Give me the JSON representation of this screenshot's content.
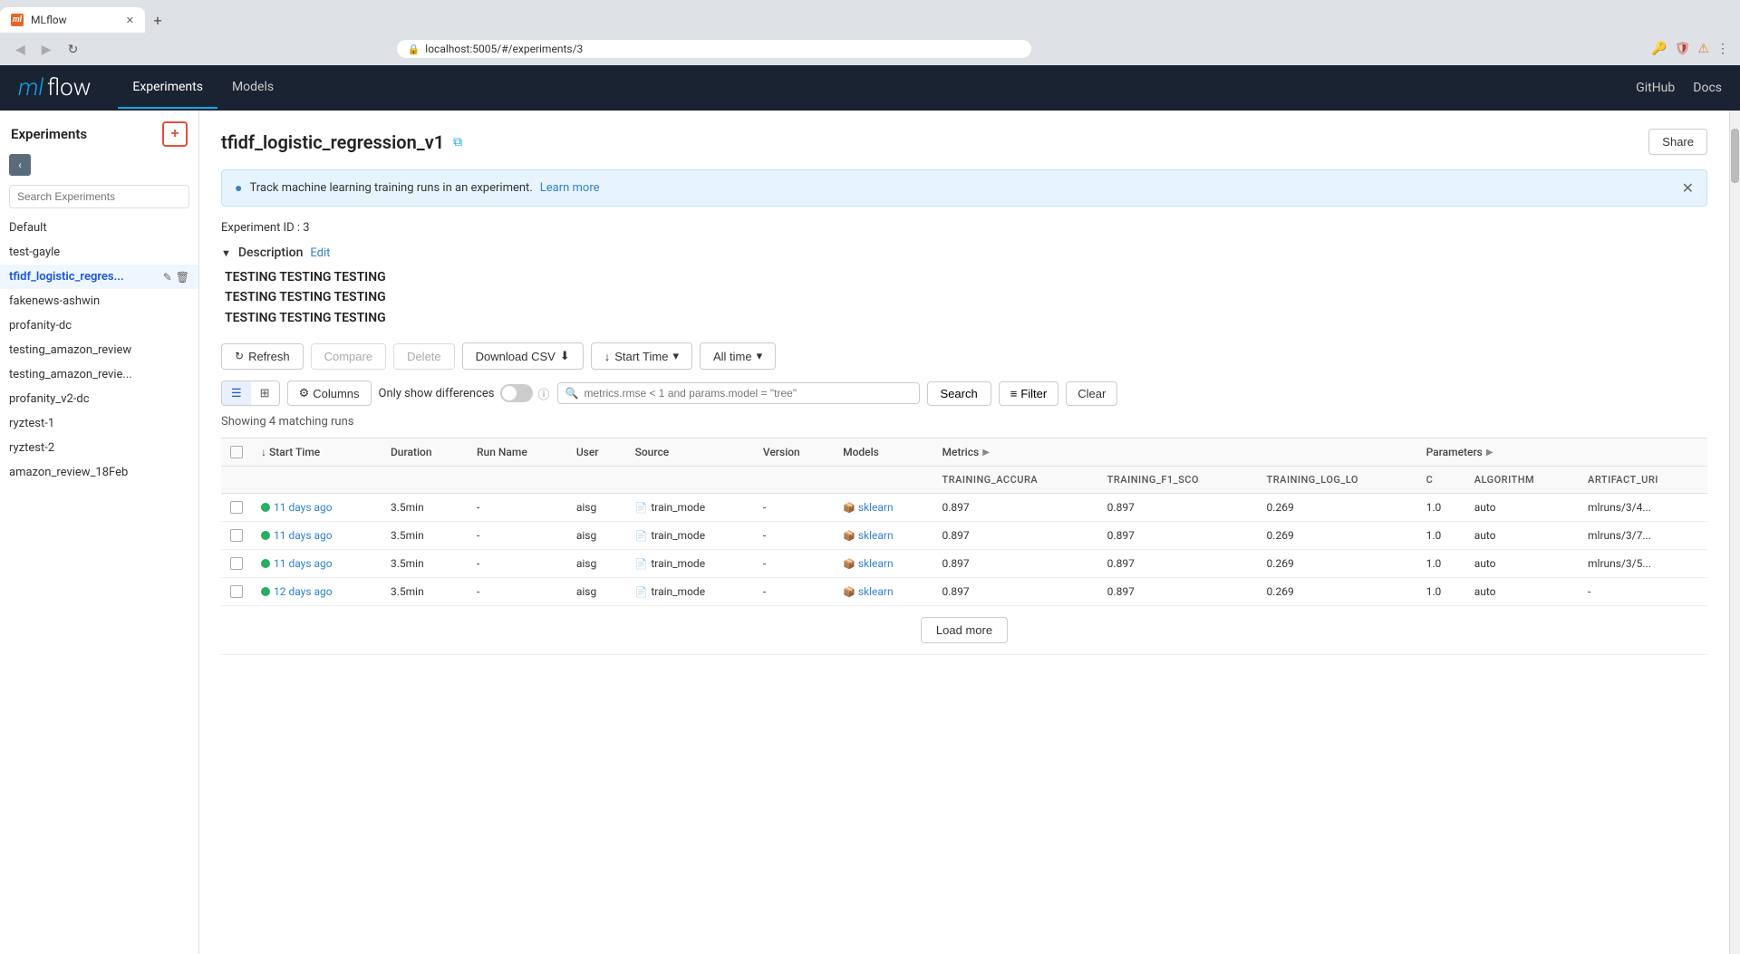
{
  "browser": {
    "tab_label": "MLflow",
    "tab_favicon": "ml",
    "url": "localhost:5005/#/experiments/3",
    "new_tab_icon": "+",
    "back_disabled": true,
    "forward_disabled": true
  },
  "header": {
    "logo_ml": "ml",
    "logo_flow": "flow",
    "nav": [
      {
        "label": "Experiments",
        "active": true
      },
      {
        "label": "Models",
        "active": false
      }
    ],
    "right_links": [
      {
        "label": "GitHub"
      },
      {
        "label": "Docs"
      }
    ]
  },
  "sidebar": {
    "title": "Experiments",
    "add_btn_label": "+",
    "collapse_btn": "‹",
    "search_placeholder": "Search Experiments",
    "items": [
      {
        "label": "Default",
        "active": false
      },
      {
        "label": "test-gayle",
        "active": false
      },
      {
        "label": "tfidf_logistic_regres...",
        "active": true
      },
      {
        "label": "fakenews-ashwin",
        "active": false
      },
      {
        "label": "profanity-dc",
        "active": false
      },
      {
        "label": "testing_amazon_review",
        "active": false
      },
      {
        "label": "testing_amazon_revie...",
        "active": false
      },
      {
        "label": "profanity_v2-dc",
        "active": false
      },
      {
        "label": "ryztest-1",
        "active": false
      },
      {
        "label": "ryztest-2",
        "active": false
      },
      {
        "label": "amazon_review_18Feb",
        "active": false
      }
    ]
  },
  "content": {
    "title": "tfidf_logistic_regression_v1",
    "share_btn": "Share",
    "info_banner": {
      "text": "Track machine learning training runs in an experiment.",
      "link_text": "Learn more"
    },
    "experiment_id_label": "Experiment ID :",
    "experiment_id_value": "3",
    "description_label": "Description",
    "description_edit": "Edit",
    "description_text_lines": [
      "TESTING TESTING TESTING",
      "TESTING TESTING TESTING",
      "TESTING TESTING TESTING"
    ],
    "toolbar": {
      "refresh_label": "Refresh",
      "compare_label": "Compare",
      "delete_label": "Delete",
      "download_csv_label": "Download CSV",
      "start_time_label": "Start Time",
      "all_time_label": "All time"
    },
    "toolbar2": {
      "columns_label": "Columns",
      "only_show_diff_label": "Only show differences",
      "search_placeholder": "metrics.rmse < 1 and params.model = \"tree\"",
      "search_btn": "Search",
      "filter_btn": "Filter",
      "clear_btn": "Clear"
    },
    "results_count": "Showing 4 matching runs",
    "table": {
      "metrics_label": "Metrics",
      "params_label": "Parameters",
      "columns": [
        {
          "label": "↓ Start Time",
          "key": "start_time"
        },
        {
          "label": "Duration",
          "key": "duration"
        },
        {
          "label": "Run Name",
          "key": "run_name"
        },
        {
          "label": "User",
          "key": "user"
        },
        {
          "label": "Source",
          "key": "source"
        },
        {
          "label": "Version",
          "key": "version"
        },
        {
          "label": "Models",
          "key": "models"
        }
      ],
      "metric_columns": [
        {
          "label": "training_accura"
        },
        {
          "label": "training_f1_sco"
        },
        {
          "label": "training_log_lo"
        }
      ],
      "param_columns": [
        {
          "label": "C"
        },
        {
          "label": "algorithm"
        },
        {
          "label": "artifact_uri"
        }
      ],
      "rows": [
        {
          "start_time": "11 days ago",
          "duration": "3.5min",
          "run_name": "-",
          "user": "aisg",
          "source": "train_mode",
          "version": "-",
          "models": "sklearn",
          "training_accuracy": "0.897",
          "training_f1": "0.897",
          "training_log": "0.269",
          "C": "1.0",
          "algorithm": "auto",
          "artifact_uri": "mlruns/3/4..."
        },
        {
          "start_time": "11 days ago",
          "duration": "3.5min",
          "run_name": "-",
          "user": "aisg",
          "source": "train_mode",
          "version": "-",
          "models": "sklearn",
          "training_accuracy": "0.897",
          "training_f1": "0.897",
          "training_log": "0.269",
          "C": "1.0",
          "algorithm": "auto",
          "artifact_uri": "mlruns/3/7..."
        },
        {
          "start_time": "11 days ago",
          "duration": "3.5min",
          "run_name": "-",
          "user": "aisg",
          "source": "train_mode",
          "version": "-",
          "models": "sklearn",
          "training_accuracy": "0.897",
          "training_f1": "0.897",
          "training_log": "0.269",
          "C": "1.0",
          "algorithm": "auto",
          "artifact_uri": "mlruns/3/5..."
        },
        {
          "start_time": "12 days ago",
          "duration": "3.5min",
          "run_name": "-",
          "user": "aisg",
          "source": "train_mode",
          "version": "-",
          "models": "sklearn",
          "training_accuracy": "0.897",
          "training_f1": "0.897",
          "training_log": "0.269",
          "C": "1.0",
          "algorithm": "auto",
          "artifact_uri": "-"
        }
      ],
      "load_more_btn": "Load more"
    }
  }
}
